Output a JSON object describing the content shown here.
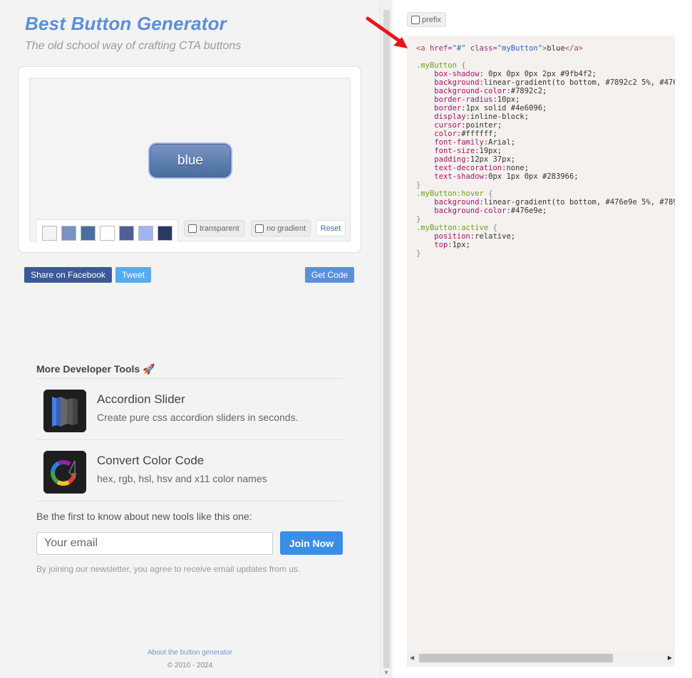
{
  "header": {
    "title": "Best Button Generator",
    "subtitle": "The old school way of crafting CTA buttons"
  },
  "preview": {
    "button_label": "blue",
    "swatches": [
      "#f4f4f4",
      "#7892c2",
      "#476e9e",
      "#ffffff",
      "#4e6096",
      "#9fb4f2",
      "#283966"
    ],
    "transparent_label": "transparent",
    "no_gradient_label": "no gradient",
    "reset_label": "Reset"
  },
  "actions": {
    "share_facebook": "Share on Facebook",
    "tweet": "Tweet",
    "get_code": "Get Code"
  },
  "tools": {
    "heading": "More Developer Tools",
    "heading_icon": "rocket-icon",
    "items": [
      {
        "name": "Accordion Slider",
        "desc": "Create pure css accordion sliders in seconds.",
        "icon": "accordion-slider-icon"
      },
      {
        "name": "Convert Color Code",
        "desc": "hex, rgb, hsl, hsv and x11 color names",
        "icon": "color-code-icon"
      }
    ]
  },
  "newsletter": {
    "label": "Be the first to know about new tools like this one:",
    "placeholder": "Your email",
    "button": "Join Now",
    "note": "By joining our newsletter, you agree to receive email updates from us."
  },
  "footer": {
    "about": "About the button generator",
    "copyright": "© 2010 - 2024"
  },
  "code_panel": {
    "prefix_label": "prefix"
  },
  "colors": {
    "accent": "#5b8fd9",
    "button_bg": "#7892c2",
    "button_border": "#4e6096",
    "facebook": "#3b5998",
    "twitter": "#55acee",
    "join": "#3a8ee6"
  }
}
